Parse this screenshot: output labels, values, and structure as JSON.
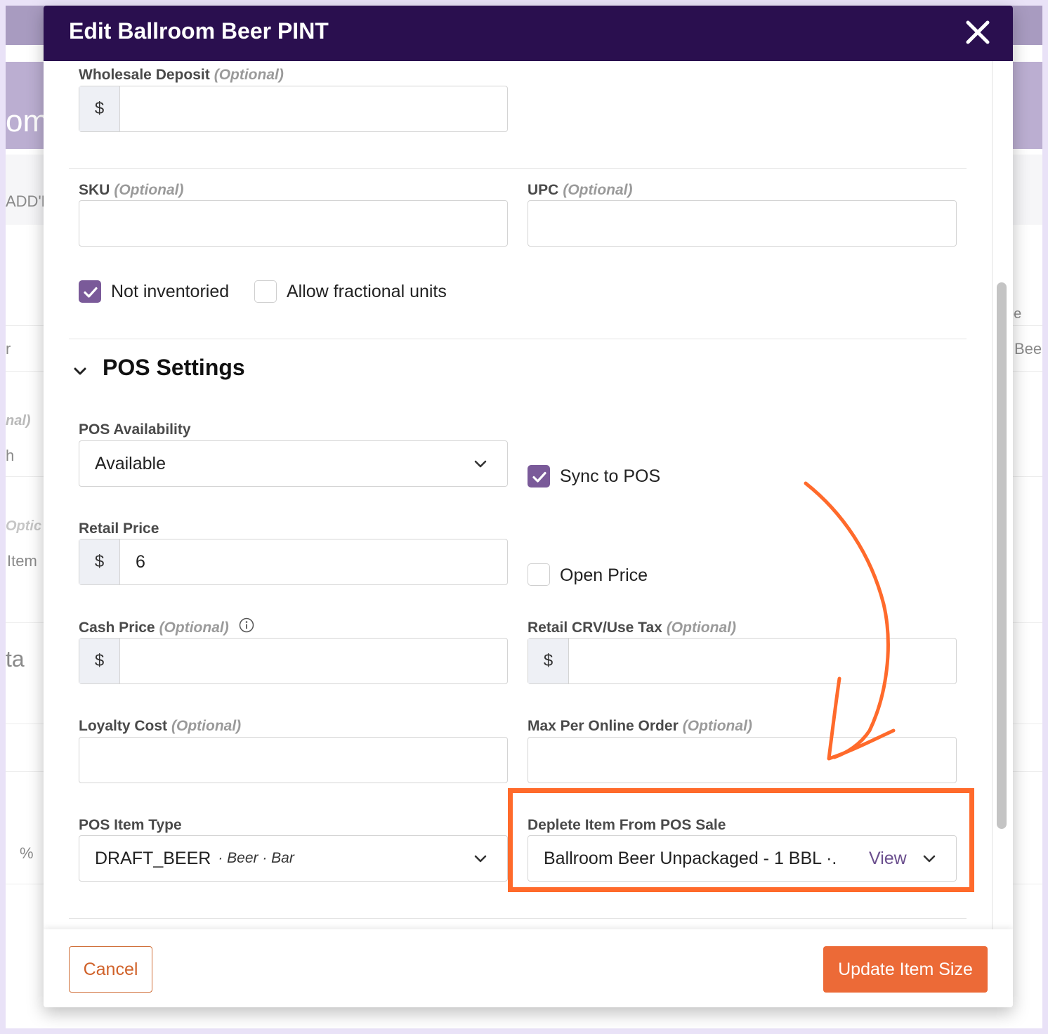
{
  "background": {
    "title_fragment": "om",
    "tab_fragment": "ADD'L",
    "left_fragments": [
      "r",
      "nal)",
      "h",
      "Optic",
      "Item",
      "ta",
      "%"
    ],
    "right_fragments": [
      "pe",
      "Bee"
    ]
  },
  "modal": {
    "title": "Edit Ballroom Beer PINT",
    "close_icon": "close-icon"
  },
  "fields": {
    "wholesale_deposit": {
      "label": "Wholesale Deposit",
      "optional": "(Optional)",
      "prefix": "$",
      "value": ""
    },
    "sku": {
      "label": "SKU",
      "optional": "(Optional)",
      "value": ""
    },
    "upc": {
      "label": "UPC",
      "optional": "(Optional)",
      "value": ""
    },
    "not_inventoried": {
      "label": "Not inventoried",
      "checked": true
    },
    "allow_fractional": {
      "label": "Allow fractional units",
      "checked": false
    }
  },
  "pos_settings": {
    "title": "POS Settings",
    "availability": {
      "label": "POS Availability",
      "value": "Available"
    },
    "sync_to_pos": {
      "label": "Sync to POS",
      "checked": true
    },
    "retail_price": {
      "label": "Retail Price",
      "prefix": "$",
      "value": "6"
    },
    "open_price": {
      "label": "Open Price",
      "checked": false
    },
    "cash_price": {
      "label": "Cash Price",
      "optional": "(Optional)",
      "prefix": "$",
      "value": ""
    },
    "retail_crv": {
      "label": "Retail CRV/Use Tax",
      "optional": "(Optional)",
      "prefix": "$",
      "value": ""
    },
    "loyalty_cost": {
      "label": "Loyalty Cost",
      "optional": "(Optional)",
      "value": ""
    },
    "max_per_order": {
      "label": "Max Per Online Order",
      "optional": "(Optional)",
      "value": ""
    },
    "pos_item_type": {
      "label": "POS Item Type",
      "value": "DRAFT_BEER",
      "sub": "· Beer · Bar"
    },
    "deplete_item": {
      "label": "Deplete Item From POS Sale",
      "value": "Ballroom Beer Unpackaged - 1 BBL  ·.",
      "view_label": "View"
    }
  },
  "footer": {
    "cancel_label": "Cancel",
    "update_label": "Update Item Size"
  },
  "colors": {
    "header_bg": "#2a0f4f",
    "accent_purple": "#7a5a99",
    "annotation_orange": "#ff6a2b",
    "primary_button": "#ec6a37"
  }
}
